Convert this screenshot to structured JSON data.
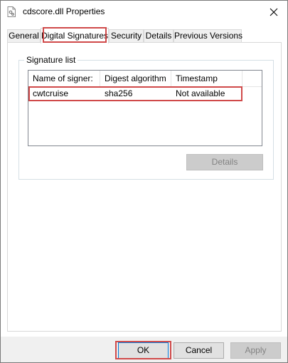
{
  "window": {
    "title": "cdscore.dll Properties",
    "file_icon": "dll-file-icon",
    "close_icon": "close-icon"
  },
  "tabs": [
    {
      "label": "General",
      "selected": false
    },
    {
      "label": "Digital Signatures",
      "selected": true
    },
    {
      "label": "Security",
      "selected": false
    },
    {
      "label": "Details",
      "selected": false
    },
    {
      "label": "Previous Versions",
      "selected": false
    }
  ],
  "signature_group": {
    "label": "Signature list",
    "columns": [
      "Name of signer:",
      "Digest algorithm",
      "Timestamp"
    ],
    "rows": [
      [
        "cwtcruise",
        "sha256",
        "Not available"
      ]
    ],
    "details_button": {
      "label": "Details",
      "enabled": false
    }
  },
  "footer": {
    "ok_label": "OK",
    "cancel_label": "Cancel",
    "apply_label": "Apply",
    "apply_enabled": false
  },
  "colors": {
    "highlight_border": "#d04a4a",
    "disabled_button_bg": "#cccccc",
    "disabled_button_text": "#838383",
    "footer_bg": "#f0f0f0"
  }
}
